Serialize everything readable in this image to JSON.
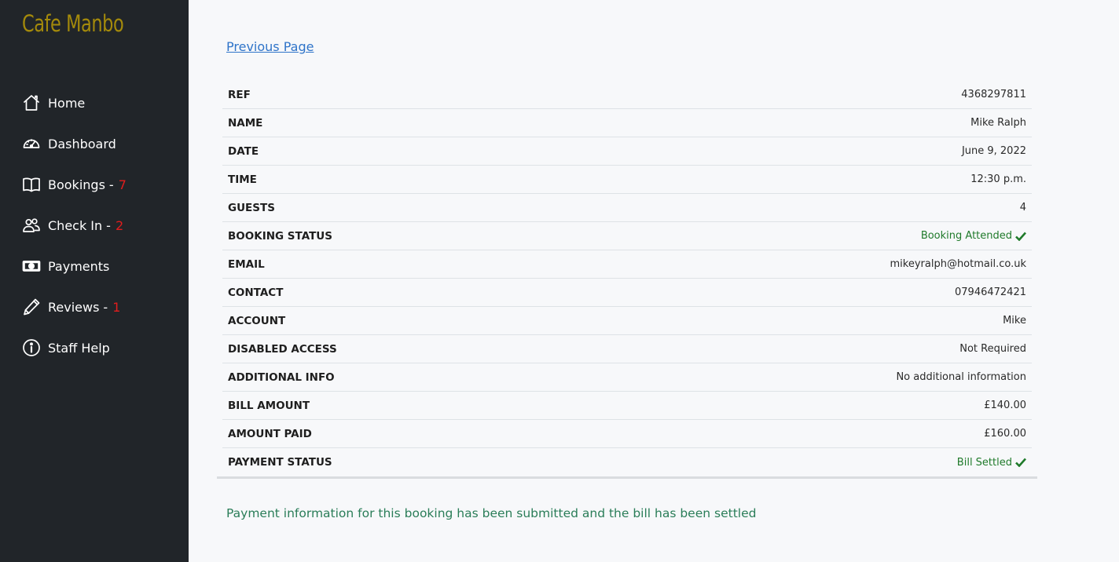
{
  "brand": "Cafe Manbo",
  "nav": [
    {
      "label": "Home",
      "icon": "home-icon",
      "count": null
    },
    {
      "label": "Dashboard",
      "icon": "speedometer-icon",
      "count": null
    },
    {
      "label": "Bookings",
      "icon": "book-icon",
      "count": "7"
    },
    {
      "label": "Check In",
      "icon": "people-icon",
      "count": "2"
    },
    {
      "label": "Payments",
      "icon": "cash-icon",
      "count": null
    },
    {
      "label": "Reviews",
      "icon": "pencil-icon",
      "count": "1"
    },
    {
      "label": "Staff Help",
      "icon": "info-circle-icon",
      "count": null
    }
  ],
  "nav_separator": "-",
  "colors": {
    "accent": "#a48a0b",
    "sidebar": "#212529",
    "count": "#e11d1d",
    "success": "#1f7a2a",
    "link": "#2f74c9"
  },
  "previous_page": "Previous Page",
  "details": [
    {
      "label": "REF",
      "value": "4368297811",
      "status": false
    },
    {
      "label": "NAME",
      "value": "Mike Ralph",
      "status": false
    },
    {
      "label": "DATE",
      "value": "June 9, 2022",
      "status": false
    },
    {
      "label": "TIME",
      "value": "12:30 p.m.",
      "status": false
    },
    {
      "label": "GUESTS",
      "value": "4",
      "status": false
    },
    {
      "label": "BOOKING STATUS",
      "value": "Booking Attended",
      "status": true
    },
    {
      "label": "EMAIL",
      "value": "mikeyralph@hotmail.co.uk",
      "status": false
    },
    {
      "label": "CONTACT",
      "value": "07946472421",
      "status": false
    },
    {
      "label": "ACCOUNT",
      "value": "Mike",
      "status": false
    },
    {
      "label": "DISABLED ACCESS",
      "value": "Not Required",
      "status": false
    },
    {
      "label": "ADDITIONAL INFO",
      "value": "No additional information",
      "status": false
    },
    {
      "label": "BILL AMOUNT",
      "value": "£140.00",
      "status": false
    },
    {
      "label": "AMOUNT PAID",
      "value": "£160.00",
      "status": false
    },
    {
      "label": "PAYMENT STATUS",
      "value": "Bill Settled",
      "status": true
    }
  ],
  "footer_message": "Payment information for this booking has been submitted and the bill has been settled"
}
